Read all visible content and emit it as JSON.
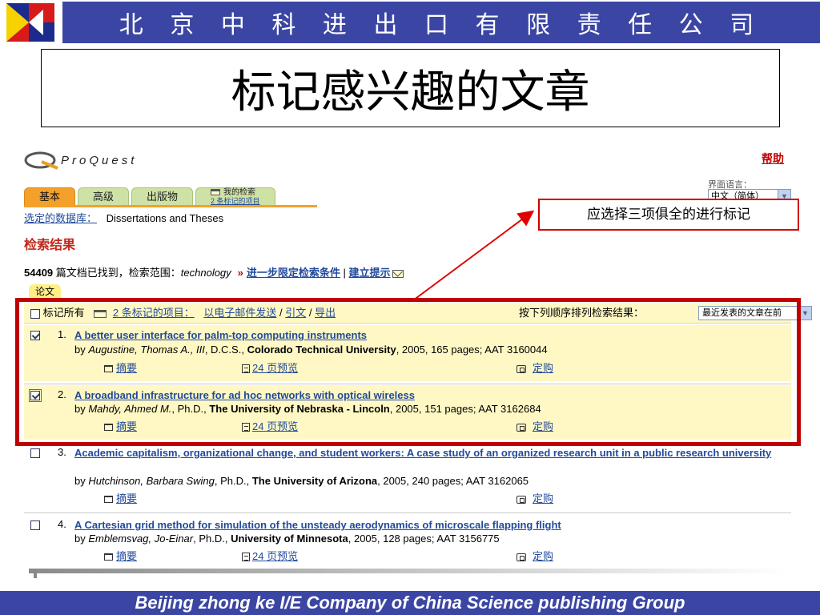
{
  "slide": {
    "company_cn": "北 京 中 科 进 出 口 有 限 责 任 公 司",
    "title": "标记感兴趣的文章",
    "footer": "Beijing  zhong ke I/E Company of China Science publishing Group",
    "annotation": "应选择三项俱全的进行标记"
  },
  "colors": {
    "brand_bar": "#3b46a4",
    "highlight_frame": "#c00000",
    "row_highlight": "#fff8c4",
    "link": "#214a9c",
    "tab_active": "#f3a12a",
    "tab_inactive": "#cfe2a6"
  },
  "proquest": {
    "logo_text": "ProQuest",
    "help": "帮助",
    "lang_label": "界面语言：",
    "lang_value": "中文（简体）",
    "tabs": [
      {
        "label": "基本",
        "active": true
      },
      {
        "label": "高级",
        "active": false
      },
      {
        "label": "出版物",
        "active": false
      },
      {
        "label": "我的检索",
        "sub": "2 条标记的项目",
        "active": false
      }
    ],
    "db_label": "选定的数据库：",
    "db_value": "Dissertations and Theses",
    "results_heading": "检索结果",
    "count": "54409",
    "count_text": " 篇文档已找到，检索范围：",
    "query": "technology",
    "refine_link": "进一步限定检索条件",
    "alert_link": "建立提示",
    "type_tab": "论文",
    "toolbar": {
      "mark_all": "标记所有",
      "marked_link": "2 条标记的项目：",
      "email": "以电子邮件发送",
      "cite": "引文",
      "export": "导出",
      "sort_label": "按下列顺序排列检索结果：",
      "sort_value": "最近发表的文章在前"
    },
    "results": [
      {
        "num": "1.",
        "checked": true,
        "title": "A better user interface for palm-top computing instruments",
        "by": "by ",
        "author": "Augustine, Thomas A., III",
        "degree": ", D.C.S., ",
        "school": "Colorado Technical University",
        "meta": ", 2005, 165 pages; AAT 3160044",
        "abstract": "摘要",
        "preview": "24 页预览",
        "buy": "定购"
      },
      {
        "num": "2.",
        "checked": true,
        "title": "A broadband infrastructure for ad hoc networks with optical wireless",
        "by": "by ",
        "author": "Mahdy, Ahmed M.",
        "degree": ", Ph.D., ",
        "school": "The University of Nebraska - Lincoln",
        "meta": ", 2005, 151 pages; AAT 3162684",
        "abstract": "摘要",
        "preview": "24 页预览",
        "buy": "定购"
      },
      {
        "num": "3.",
        "checked": false,
        "title": "Academic capitalism, organizational change, and student workers: A case study of an organized research unit in a public research university",
        "by": "by ",
        "author": "Hutchinson, Barbara Swing",
        "degree": ", Ph.D., ",
        "school": "The University of Arizona",
        "meta": ", 2005, 240 pages; AAT 3162065",
        "abstract": "摘要",
        "buy": "定购"
      },
      {
        "num": "4.",
        "checked": false,
        "title": "A Cartesian grid method for simulation of the unsteady aerodynamics of microscale flapping flight",
        "by": "by ",
        "author": "Emblemsvag, Jo-Einar",
        "degree": ", Ph.D., ",
        "school": "University of Minnesota",
        "meta": ", 2005, 128 pages; AAT 3156775",
        "abstract": "摘要",
        "preview": "24 页预览",
        "buy": "定购"
      }
    ]
  }
}
